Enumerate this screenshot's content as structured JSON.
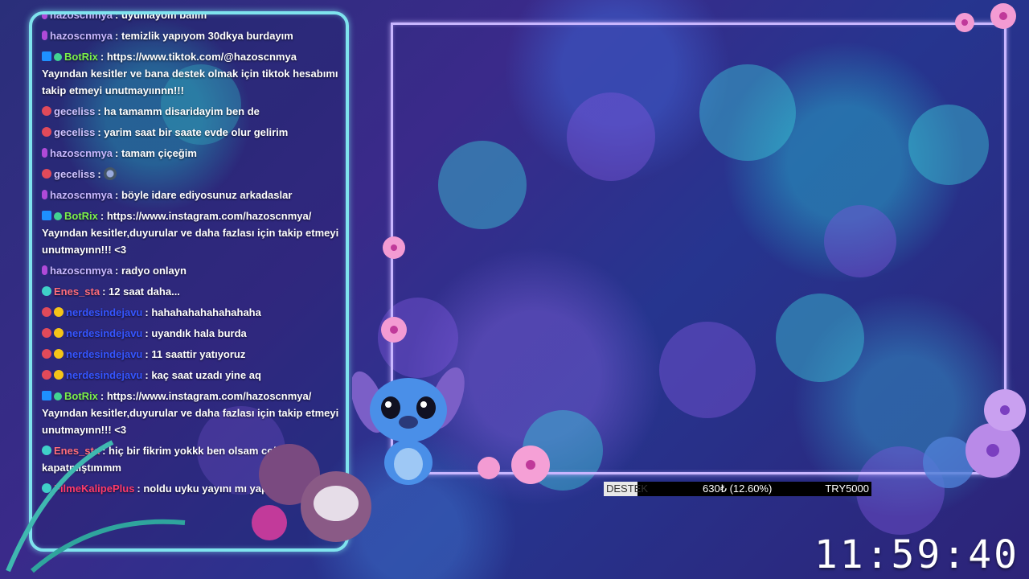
{
  "chat": {
    "messages": [
      {
        "badge": "purple",
        "user": "hazoscnmya",
        "text": ": uyumayom balım",
        "name_class": "n-hazo"
      },
      {
        "badge": "purple",
        "user": "hazoscnmya",
        "text": ": temizlik yapıyom 30dkya burdayım",
        "name_class": "n-hazo"
      },
      {
        "badge": "bot",
        "user": "BotRix",
        "text": ": https://www.tiktok.com/@hazoscnmya Yayından kesitler ve bana destek olmak için tiktok hesabımı takip etmeyi unutmayıınnn!!!",
        "name_class": "n-bot"
      },
      {
        "badge": "devil",
        "user": "geceliss",
        "text": ": ha tamamm disaridayim ben de",
        "name_class": "n-gec"
      },
      {
        "badge": "devil",
        "user": "geceliss",
        "text": ": yarim saat bir saate evde olur gelirim",
        "name_class": "n-gec"
      },
      {
        "badge": "purple",
        "user": "hazoscnmya",
        "text": ": tamam çiçeğim",
        "name_class": "n-hazo"
      },
      {
        "badge": "devil",
        "user": "geceliss",
        "text": ":",
        "name_class": "n-gec",
        "emote": true
      },
      {
        "badge": "purple",
        "user": "hazoscnmya",
        "text": ": böyle idare ediyosunuz arkadaslar",
        "name_class": "n-hazo"
      },
      {
        "badge": "bot",
        "user": "BotRix",
        "text": ": https://www.instagram.com/hazoscnmya/ Yayından kesitler,duyurular ve daha fazlası için takip etmeyi unutmayınn!!! <3",
        "name_class": "n-bot"
      },
      {
        "badge": "purple",
        "user": "hazoscnmya",
        "text": ": radyo onlayn",
        "name_class": "n-hazo"
      },
      {
        "badge": "teal",
        "user": "Enes_sta",
        "text": ": 12 saat daha...",
        "name_class": "n-enes"
      },
      {
        "badge": "devil",
        "user": "nerdesindejavu",
        "text": ": hahahahahahahahaha",
        "name_class": "n-nerd"
      },
      {
        "badge": "devil",
        "user": "nerdesindejavu",
        "text": ": uyandık hala burda",
        "name_class": "n-nerd"
      },
      {
        "badge": "devil",
        "user": "nerdesindejavu",
        "text": ": 11 saattir yatıyoruz",
        "name_class": "n-nerd"
      },
      {
        "badge": "devil",
        "user": "nerdesindejavu",
        "text": ": kaç saat uzadı yine aq",
        "name_class": "n-nerd"
      },
      {
        "badge": "bot",
        "user": "BotRix",
        "text": ": https://www.instagram.com/hazoscnmya/ Yayından kesitler,duyurular ve daha fazlası için takip etmeyi unutmayınn!!! <3",
        "name_class": "n-bot"
      },
      {
        "badge": "teal",
        "user": "Enes_sta",
        "text": ": hiç bir fikrim yokkk ben olsam coktan kapatmıştımmm",
        "name_class": "n-enes"
      },
      {
        "badge": "teal",
        "user": "FilmeKalipePlus",
        "text": ": noldu uyku yayını mı yaptı",
        "name_class": "n-filo"
      }
    ]
  },
  "donation": {
    "label": "DESTEK",
    "amount": "630₺ (12.60%)",
    "goal": "TRY5000",
    "progress": 0.126
  },
  "clock": {
    "time": "11:59:40"
  },
  "colors": {
    "chat_border": "#7fe3ee",
    "frame_border": "#c9b6ff",
    "bot_name": "#7cf24a"
  }
}
